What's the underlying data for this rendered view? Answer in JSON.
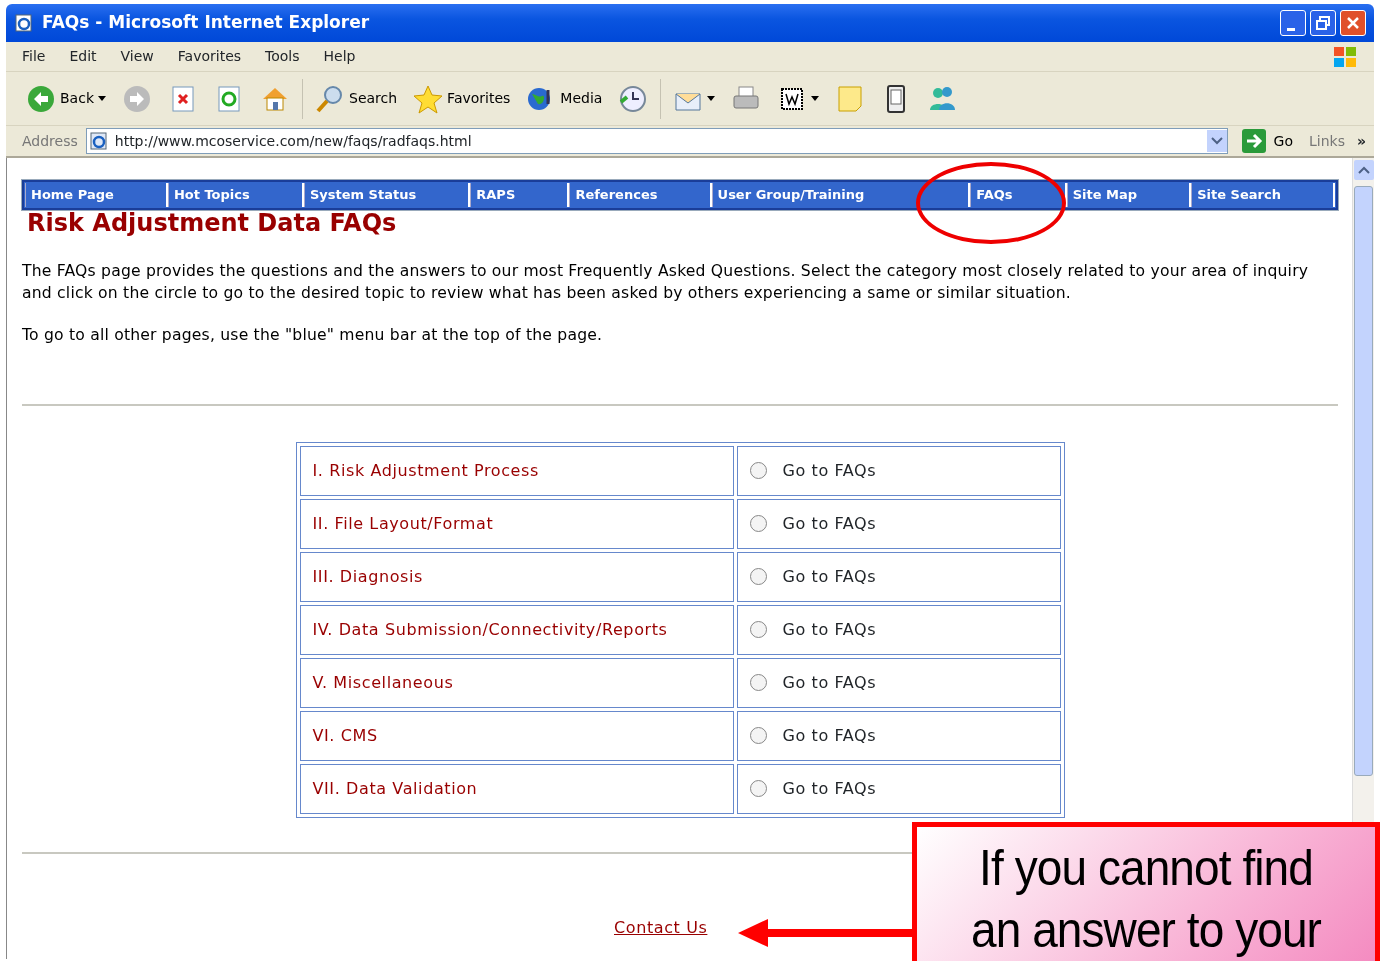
{
  "window": {
    "title": "FAQs - Microsoft Internet Explorer"
  },
  "menu_bar": [
    "File",
    "Edit",
    "View",
    "Favorites",
    "Tools",
    "Help"
  ],
  "toolbar": {
    "back": "Back",
    "search": "Search",
    "favorites": "Favorites",
    "media": "Media"
  },
  "address_bar": {
    "label": "Address",
    "url": "http://www.mcoservice.com/new/faqs/radfaqs.html",
    "go": "Go",
    "links": "Links",
    "more": "»"
  },
  "nav": [
    "Home Page",
    "Hot Topics",
    "System Status",
    "RAPS",
    "References",
    "User Group/Training",
    "FAQs",
    "Site Map",
    "Site Search"
  ],
  "heading": "Risk Adjustment Data FAQs",
  "paragraphs": [
    "The FAQs page provides the questions and the answers to our most Frequently Asked Questions. Select the category most closely related to your area of inquiry and click on the circle to go to the desired topic to review what has been asked by others experiencing a same or similar situation.",
    "To go to all other pages, use the \"blue\" menu bar at the top of the page."
  ],
  "categories": [
    {
      "title": "I. Risk Adjustment Process",
      "option": "Go to FAQs",
      "selected": false
    },
    {
      "title": "II. File Layout/Format",
      "option": "Go to FAQs",
      "selected": false
    },
    {
      "title": "III. Diagnosis",
      "option": "Go to FAQs",
      "selected": false
    },
    {
      "title": "IV. Data Submission/Connectivity/Reports",
      "option": "Go to FAQs",
      "selected": false
    },
    {
      "title": "V. Miscellaneous",
      "option": "Go to FAQs",
      "selected": false
    },
    {
      "title": "VI. CMS",
      "option": "Go to FAQs",
      "selected": false
    },
    {
      "title": "VII. Data Validation",
      "option": "Go to FAQs",
      "selected": false
    }
  ],
  "contact_link": "Contact Us",
  "callout": [
    "If you cannot find",
    "an answer to your"
  ]
}
